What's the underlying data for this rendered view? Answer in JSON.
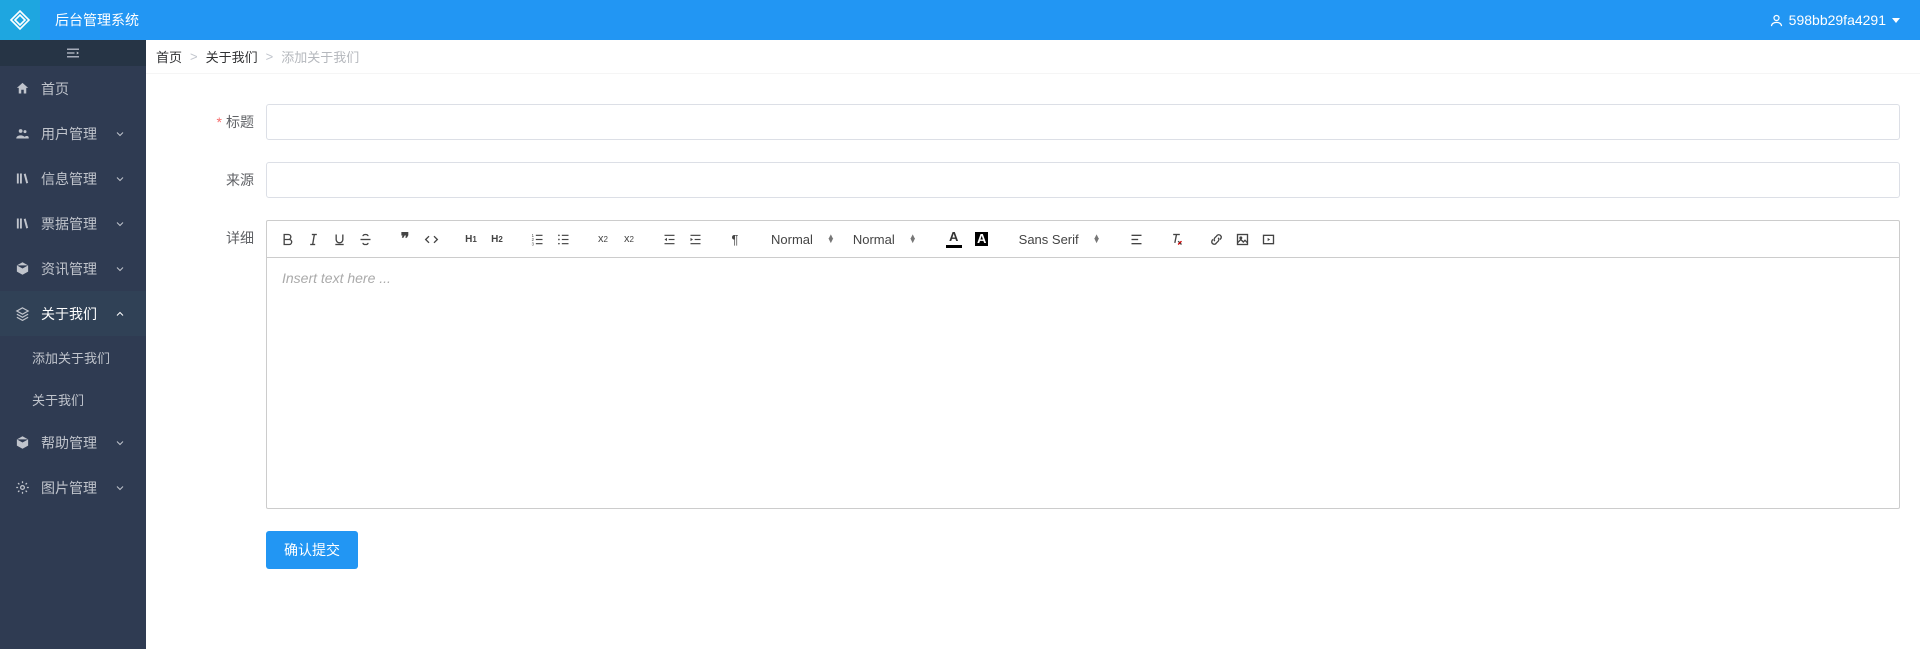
{
  "app": {
    "title": "后台管理系统",
    "user": "598bb29fa4291"
  },
  "sidebar": {
    "home": "首页",
    "users": "用户管理",
    "info": "信息管理",
    "tickets": "票据管理",
    "news": "资讯管理",
    "about": "关于我们",
    "about_children": {
      "add": "添加关于我们",
      "list": "关于我们"
    },
    "help": "帮助管理",
    "images": "图片管理"
  },
  "breadcrumb": {
    "home": "首页",
    "about": "关于我们",
    "current": "添加关于我们"
  },
  "form": {
    "title_label": "标题",
    "title_value": "",
    "source_label": "来源",
    "source_value": "",
    "detail_label": "详细",
    "editor_placeholder": "Insert text here ...",
    "submit": "确认提交"
  },
  "editor": {
    "picker_header": "Normal",
    "picker_size": "Normal",
    "picker_font": "Sans Serif"
  }
}
